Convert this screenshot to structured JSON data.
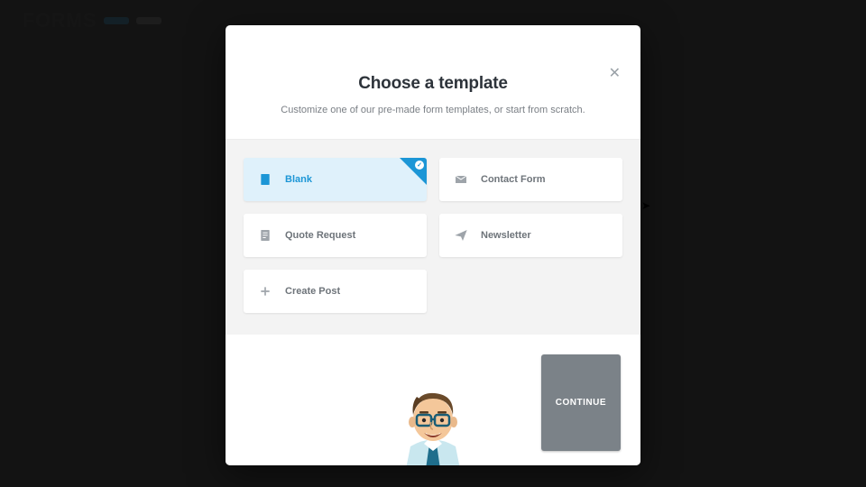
{
  "background": {
    "title": "FORMS",
    "chip1": " ",
    "chip2": " "
  },
  "modal": {
    "title": "Choose a template",
    "subtitle": "Customize one of our pre-made form templates, or start from scratch."
  },
  "templates": {
    "blank": {
      "label": "Blank",
      "icon": "file-icon",
      "selected": true
    },
    "contact": {
      "label": "Contact Form",
      "icon": "envelope-icon",
      "selected": false
    },
    "quote": {
      "label": "Quote Request",
      "icon": "document-icon",
      "selected": false
    },
    "newsletter": {
      "label": "Newsletter",
      "icon": "paper-plane-icon",
      "selected": false
    },
    "create_post": {
      "label": "Create Post",
      "icon": "plus-icon",
      "selected": false
    }
  },
  "footer": {
    "continue_label": "CONTINUE"
  }
}
